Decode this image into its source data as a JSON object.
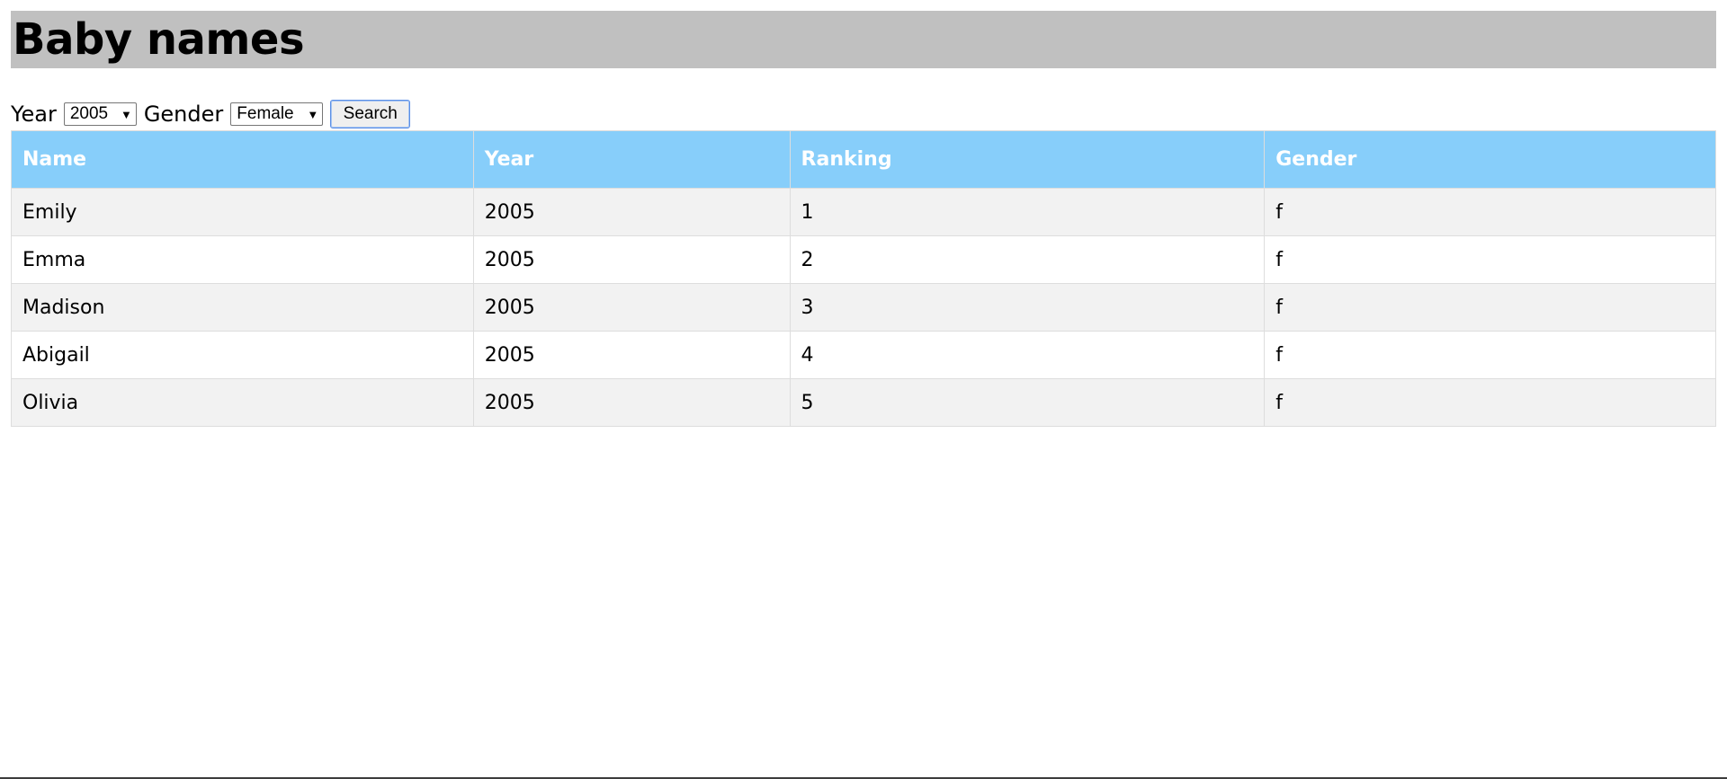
{
  "header": {
    "title": "Baby names"
  },
  "filters": {
    "year_label": "Year",
    "year_value": "2005",
    "gender_label": "Gender",
    "gender_value": "Female",
    "search_label": "Search"
  },
  "table": {
    "headers": [
      "Name",
      "Year",
      "Ranking",
      "Gender"
    ],
    "rows": [
      [
        "Emily",
        "2005",
        "1",
        "f"
      ],
      [
        "Emma",
        "2005",
        "2",
        "f"
      ],
      [
        "Madison",
        "2005",
        "3",
        "f"
      ],
      [
        "Abigail",
        "2005",
        "4",
        "f"
      ],
      [
        "Olivia",
        "2005",
        "5",
        "f"
      ]
    ]
  },
  "colors": {
    "title_bar": "#c0c0c0",
    "header_row": "#87cefa",
    "striped_row": "#f2f2f2"
  },
  "icons": {
    "dropdown": "triangle-down"
  }
}
